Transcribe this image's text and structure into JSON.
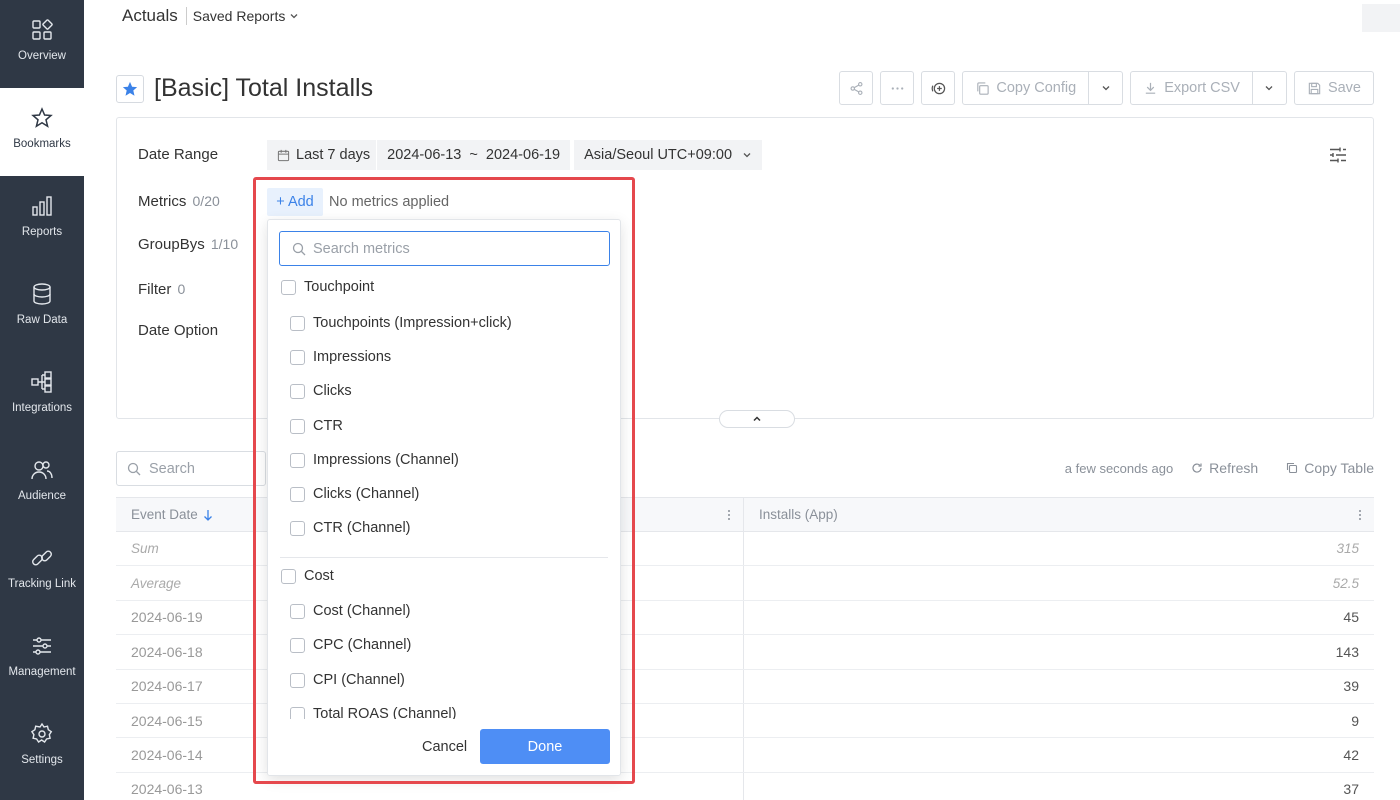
{
  "sidebar": {
    "items": [
      {
        "label": "Overview",
        "icon": "overview-icon"
      },
      {
        "label": "Bookmarks",
        "icon": "star-icon",
        "active": true
      },
      {
        "label": "Reports",
        "icon": "bar-chart-icon"
      },
      {
        "label": "Raw Data",
        "icon": "database-icon"
      },
      {
        "label": "Integrations",
        "icon": "integrations-icon"
      },
      {
        "label": "Audience",
        "icon": "audience-icon"
      },
      {
        "label": "Tracking Link",
        "icon": "link-icon"
      },
      {
        "label": "Management",
        "icon": "sliders-icon"
      },
      {
        "label": "Settings",
        "icon": "gear-icon"
      }
    ]
  },
  "header": {
    "breadcrumb_root": "Actuals",
    "saved_reports": "Saved Reports",
    "title": "[Basic] Total Installs"
  },
  "toolbar": {
    "copy_config": "Copy Config",
    "export_csv": "Export CSV",
    "save": "Save"
  },
  "config": {
    "date_range_label": "Date Range",
    "date_preset": "Last 7 days",
    "date_span": "2024-06-13  ~  2024-06-19",
    "timezone": "Asia/Seoul UTC+09:00",
    "metrics_label": "Metrics",
    "metrics_count": "0/20",
    "add_label": "+ Add",
    "no_metrics": "No metrics applied",
    "groupbys_label": "GroupBys",
    "groupbys_count": "1/10",
    "filter_label": "Filter",
    "filter_count": "0",
    "date_option_label": "Date Option"
  },
  "dropdown": {
    "search_placeholder": "Search metrics",
    "groups": [
      {
        "label": "Touchpoint",
        "items": [
          "Touchpoints (Impression+click)",
          "Impressions",
          "Clicks",
          "CTR",
          "Impressions (Channel)",
          "Clicks (Channel)",
          "CTR (Channel)"
        ]
      },
      {
        "label": "Cost",
        "items": [
          "Cost (Channel)",
          "CPC (Channel)",
          "CPI (Channel)",
          "Total ROAS (Channel)"
        ]
      }
    ],
    "cancel": "Cancel",
    "done": "Done"
  },
  "table_toolbar": {
    "search_placeholder": "Search",
    "updated": "a few seconds ago",
    "refresh": "Refresh",
    "copy_table": "Copy Table"
  },
  "table": {
    "columns": [
      "Event Date",
      "Installs (App)"
    ],
    "rows": [
      {
        "date": "Sum",
        "value": "315",
        "agg": true
      },
      {
        "date": "Average",
        "value": "52.5",
        "agg": true
      },
      {
        "date": "2024-06-19",
        "value": "45"
      },
      {
        "date": "2024-06-18",
        "value": "143"
      },
      {
        "date": "2024-06-17",
        "value": "39"
      },
      {
        "date": "2024-06-15",
        "value": "9"
      },
      {
        "date": "2024-06-14",
        "value": "42"
      },
      {
        "date": "2024-06-13",
        "value": "37"
      }
    ]
  },
  "colors": {
    "sidebar_bg": "#2f3845",
    "accent": "#3b82e8",
    "highlight": "#e5484d"
  }
}
